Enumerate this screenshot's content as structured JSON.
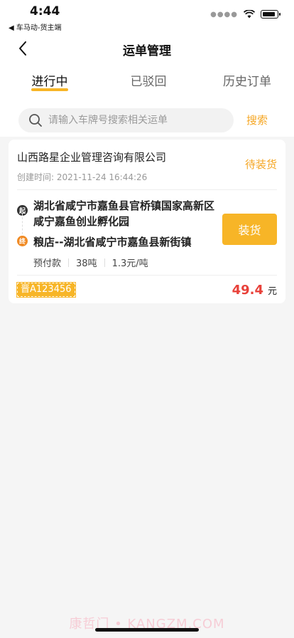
{
  "status_bar": {
    "time": "4:44",
    "back_app": "◀ 车马动-货主端"
  },
  "nav": {
    "title": "运单管理"
  },
  "tabs": [
    {
      "label": "进行中",
      "active": true
    },
    {
      "label": "已驳回",
      "active": false
    },
    {
      "label": "历史订单",
      "active": false
    }
  ],
  "search": {
    "placeholder": "请输入车牌号搜索相关运单",
    "value": "",
    "button_label": "搜索"
  },
  "order": {
    "company": "山西路星企业管理咨询有限公司",
    "status": "待装货",
    "created_at": "创建时间: 2021-11-24 16:44:26",
    "start_badge": "起",
    "end_badge": "终",
    "origin": "湖北省咸宁市嘉鱼县官桥镇国家高新区咸宁嘉鱼创业孵化园",
    "destination": "粮店--湖北省咸宁市嘉鱼县新街镇",
    "payment": "预付款",
    "weight": "38吨",
    "rate": "1.3元/吨",
    "action_label": "装货",
    "plate": "晋A123456",
    "price": "49.4",
    "price_unit": "元"
  },
  "watermark": "康哲门 • KANGZM.COM",
  "colors": {
    "accent": "#f7b527",
    "status_text": "#f5a623",
    "price": "#e8413a"
  }
}
